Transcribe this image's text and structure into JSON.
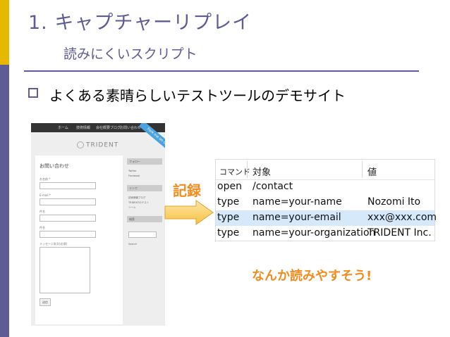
{
  "slide": {
    "title": "1. キャプチャーリプレイ",
    "subtitle": "読みにくいスクリプト",
    "bullet": "よくある素晴らしいテストツールのデモサイト",
    "record_label": "記録",
    "comment": "なんか読みやすそう!"
  },
  "colors": {
    "accent_yellow": "#e6b800",
    "accent_purple": "#5e5b95",
    "highlight_orange": "#f28c1e",
    "selected_row": "#d6e9fb"
  },
  "demo_site": {
    "nav": [
      "ホーム",
      "技術情報",
      "会社概要ブログ",
      "お問い合わせ"
    ],
    "ribbon": "Fork me on GitHub",
    "logo": "TRIDENT",
    "form_title": "お問い合わせ",
    "fields": [
      "お名前 *",
      "E-mail *",
      "件名",
      "件名"
    ],
    "message_label": "メッセージ本文(必須)",
    "submit": "送信",
    "side_sections": [
      "フォロー",
      "リンク",
      "検索"
    ],
    "side_texts": [
      "Twitter",
      "Facebook",
      "技術情報ブログ",
      "TRIDENTのテスト",
      "ツール"
    ],
    "search_button": "Search"
  },
  "command_table": {
    "headers": [
      "コマンド",
      "対象",
      "値"
    ],
    "rows": [
      {
        "command": "open",
        "target": "/contact",
        "value": ""
      },
      {
        "command": "type",
        "target": "name=your-name",
        "value": "Nozomi Ito"
      },
      {
        "command": "type",
        "target": "name=your-email",
        "value": "xxx@xxx.com"
      },
      {
        "command": "type",
        "target": "name=your-organization",
        "value": "TRIDENT Inc."
      }
    ],
    "selected_row_index": 2
  }
}
